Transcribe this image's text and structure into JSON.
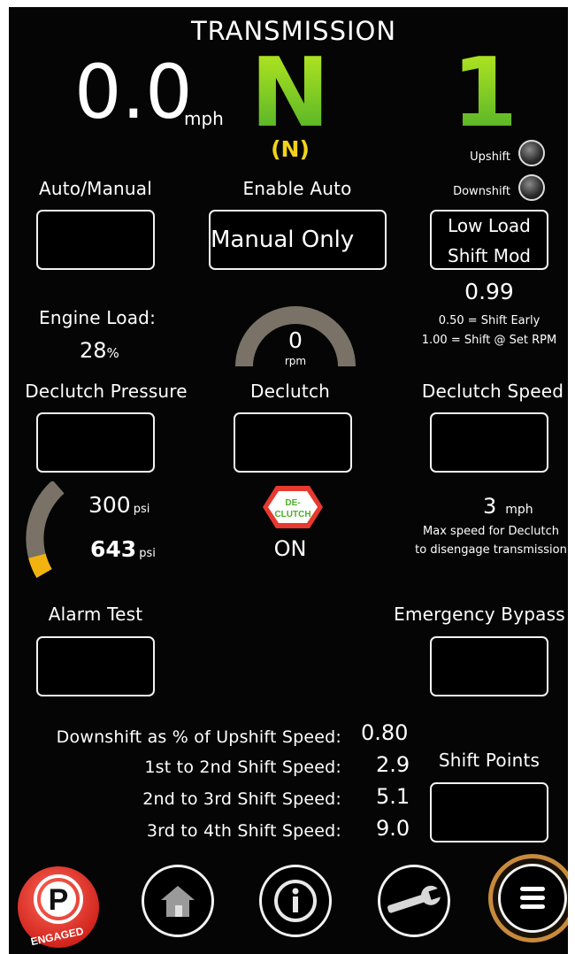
{
  "header": {
    "title": "TRANSMISSION"
  },
  "speed": {
    "value": "0.0",
    "unit": "mph"
  },
  "gear": {
    "current": "N",
    "selected": "(N)",
    "range": "1"
  },
  "indicators": {
    "upshift": "Upshift",
    "downshift": "Downshift"
  },
  "auto_manual": {
    "label": "Auto/Manual"
  },
  "enable_auto": {
    "label": "Enable Auto",
    "value": "Manual Only"
  },
  "low_load": {
    "line1": "Low Load",
    "line2": "Shift Mod",
    "value": "0.99",
    "hint1": "0.50 = Shift Early",
    "hint2": "1.00 = Shift @ Set RPM"
  },
  "engine_load": {
    "label": "Engine Load:",
    "value": "28",
    "unit": "%"
  },
  "rpm_gauge": {
    "value": "0",
    "unit": "rpm"
  },
  "declutch_pressure": {
    "label": "Declutch Pressure",
    "setpoint": "300",
    "actual": "643",
    "unit": "psi",
    "gauge_fraction": 0.2
  },
  "declutch": {
    "label": "Declutch",
    "sign_line1": "DE-",
    "sign_line2": "CLUTCH",
    "state": "ON"
  },
  "declutch_speed": {
    "label": "Declutch Speed",
    "value": "3",
    "unit": "mph",
    "hint1": "Max speed for Declutch",
    "hint2": "to disengage transmission"
  },
  "alarm_test": {
    "label": "Alarm Test"
  },
  "emergency_bypass": {
    "label": "Emergency Bypass"
  },
  "shift_settings": {
    "rows": [
      {
        "label": "Downshift as % of Upshift Speed:",
        "value": "0.80"
      },
      {
        "label": "1st to 2nd Shift Speed:",
        "value": "2.9"
      },
      {
        "label": "2nd to 3rd Shift Speed:",
        "value": "5.1"
      },
      {
        "label": "3rd to 4th Shift Speed:",
        "value": "9.0"
      }
    ],
    "shift_points_label": "Shift Points"
  },
  "nav": {
    "parking_letter": "P",
    "parking_status": "ENGAGED"
  },
  "colors": {
    "gear_green": "#5fc12a",
    "gear_yellow": "#f2d21b",
    "gauge_track": "#7a7266",
    "gauge_fill": "#f2b311",
    "menu_ring": "#c88a3c",
    "parking_red": "#e8392f"
  }
}
